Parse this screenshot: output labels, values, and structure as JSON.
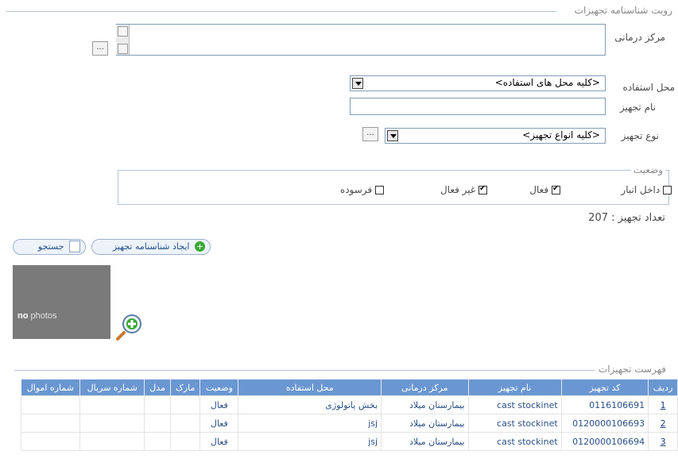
{
  "filters": {
    "legend": "روبت شناسنامه تجهیزات",
    "medical_center_label": "مرکز درمانی",
    "medical_center_browse": "...",
    "usage_location_label": "محل استفاده",
    "usage_location_value": "<کلیه محل های استفاده>",
    "equipment_name_label": "نام تجهیز",
    "equipment_name_value": "",
    "equipment_type_label": "نوع تجهیز",
    "equipment_type_value": "<کلیه انواع تجهیز>",
    "equipment_type_browse": "..."
  },
  "status": {
    "legend": "وضعیت",
    "options": [
      {
        "label": "داخل انبار",
        "checked": false
      },
      {
        "label": "فعال",
        "checked": true
      },
      {
        "label": "غیر فعال",
        "checked": true
      },
      {
        "label": "فرسوده",
        "checked": false
      }
    ]
  },
  "count": {
    "label": "تعداد تجهیز : 207"
  },
  "actions": {
    "search_label": "جستجو",
    "create_label": "ایجاد شناسنامه تجهیز"
  },
  "photo": {
    "placeholder_bold": "no",
    "placeholder_text": " photos",
    "add_icon": "magnifier-plus-icon"
  },
  "list": {
    "legend": "فهرست تجهیزات",
    "columns": [
      "ردیف",
      "کد تجهیز",
      "نام تجهیز",
      "مرکز درمانی",
      "محل استفاده",
      "وضعیت",
      "مارک",
      "مدل",
      "شماره سریال",
      "شماره اموال"
    ],
    "rows": [
      {
        "row": "1",
        "code": "0116106691",
        "name": "cast stockinet",
        "center": "بیمارستان میلاد",
        "location": "بخش پاتولوژی",
        "status": "فعال",
        "brand": "",
        "model": "",
        "serial": "",
        "asset": ""
      },
      {
        "row": "2",
        "code": "0120000106693",
        "name": "cast stockinet",
        "center": "بیمارستان میلاد",
        "location": "jsj",
        "status": "فعال",
        "brand": "",
        "model": "",
        "serial": "",
        "asset": ""
      },
      {
        "row": "3",
        "code": "0120000106694",
        "name": "cast stockinet",
        "center": "بیمارستان میلاد",
        "location": "jsj",
        "status": "فعال",
        "brand": "",
        "model": "",
        "serial": "",
        "asset": ""
      }
    ]
  },
  "colors": {
    "header_blue": "#6a97d1",
    "link_blue": "#2a4f88",
    "frame_line": "#b5c3d6"
  }
}
